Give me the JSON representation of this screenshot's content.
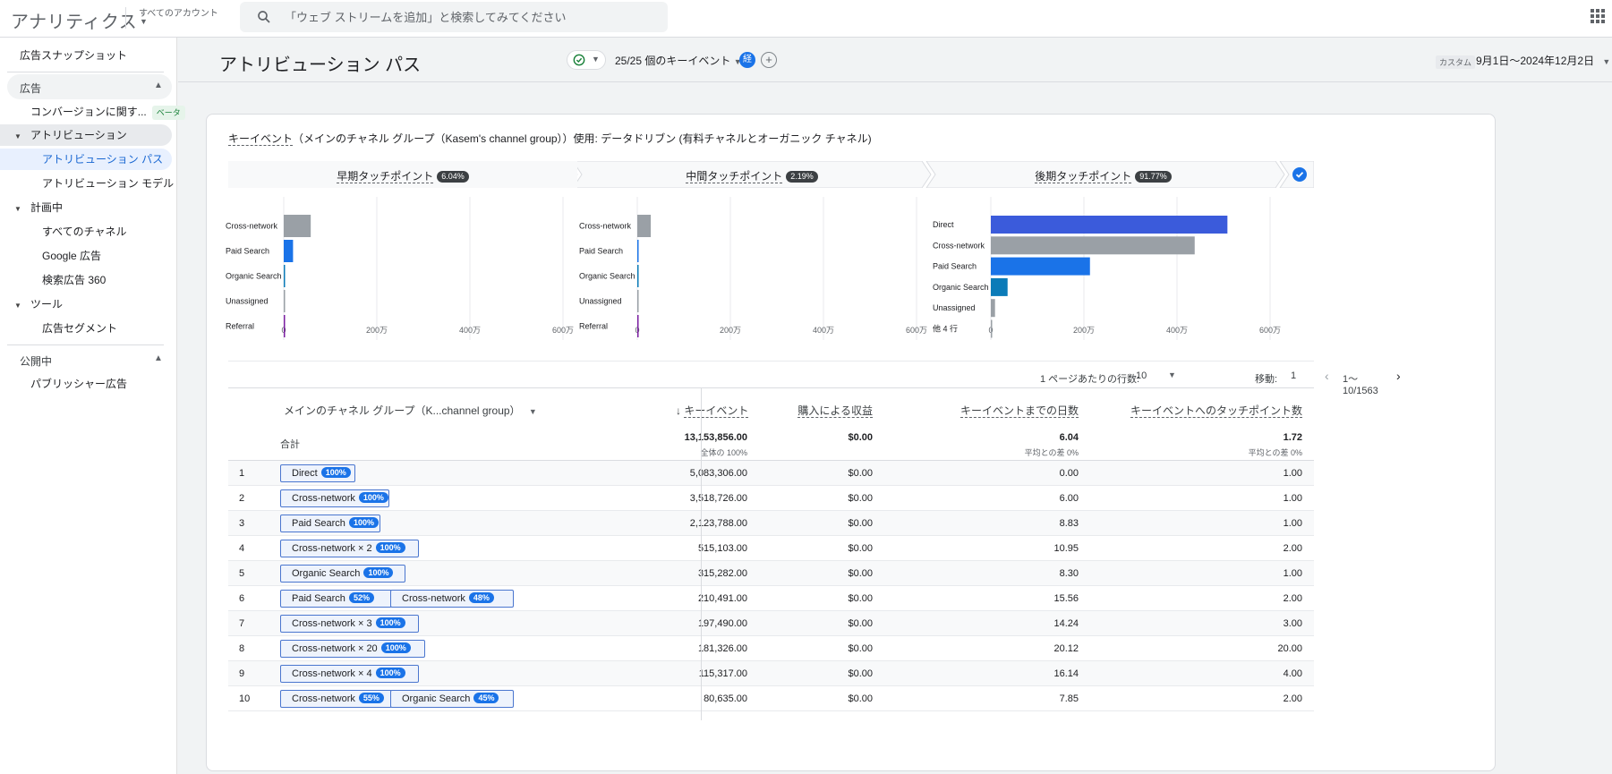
{
  "app": {
    "title": "アナリティクス",
    "account_label": "すべてのアカウント"
  },
  "search": {
    "placeholder": "「ウェブ ストリームを追加」と検索してみてください"
  },
  "sidebar": {
    "snapshot": "広告スナップショット",
    "sections": {
      "ads": "広告",
      "published": "公開中"
    },
    "items": {
      "conversion": "コンバージョンに関す...",
      "conversion_badge": "ベータ",
      "attribution": "アトリビューション",
      "attribution_paths": "アトリビューション パス",
      "attribution_model": "アトリビューション モデル",
      "planning": "計画中",
      "all_channels": "すべてのチャネル",
      "google_ads": "Google 広告",
      "sa360": "検索広告 360",
      "tools": "ツール",
      "segments": "広告セグメント",
      "publisher_ads": "パブリッシャー広告"
    }
  },
  "header": {
    "title": "アトリビューション パス",
    "events_dropdown": "25/25 個のキーイベント",
    "badge": "経",
    "add": "+",
    "date_custom": "カスタム",
    "date_range": "9月1日～2024年12月2日"
  },
  "filter": {
    "key_event": "キーイベント",
    "text": "（メインのチャネル グループ（Kasem's channel group））使用: データドリブン (有料チャネルとオーガニック チャネル)"
  },
  "touchpoints": [
    {
      "label": "早期タッチポイント",
      "pct": "6.04%"
    },
    {
      "label": "中間タッチポイント",
      "pct": "2.19%"
    },
    {
      "label": "後期タッチポイント",
      "pct": "91.77%"
    }
  ],
  "colors": {
    "accent": "#1a73e8",
    "direct": "#3b5bdb",
    "cross_network": "#9aa0a6",
    "paid_search": "#1a73e8",
    "organic_search": "#0b7bb8",
    "unassigned": "#9aa0a6",
    "referral": "#7b1fa2"
  },
  "chart_data": [
    {
      "type": "bar",
      "orientation": "horizontal",
      "categories": [
        "Cross-network",
        "Paid Search",
        "Organic Search",
        "Unassigned",
        "Referral"
      ],
      "values": [
        580000,
        200000,
        20000,
        10000,
        10000
      ],
      "xlim": [
        0,
        6000000
      ],
      "x_ticks": [
        "0",
        "200万",
        "400万",
        "600万"
      ]
    },
    {
      "type": "bar",
      "orientation": "horizontal",
      "categories": [
        "Cross-network",
        "Paid Search",
        "Organic Search",
        "Unassigned",
        "Referral"
      ],
      "values": [
        290000,
        20000,
        15000,
        10000,
        10000
      ],
      "xlim": [
        0,
        6000000
      ],
      "x_ticks": [
        "0",
        "200万",
        "400万",
        "600万"
      ]
    },
    {
      "type": "bar",
      "orientation": "horizontal",
      "categories": [
        "Direct",
        "Cross-network",
        "Paid Search",
        "Organic Search",
        "Unassigned",
        "他 4 行"
      ],
      "values": [
        5083306,
        4380000,
        2130000,
        360000,
        90000,
        20000
      ],
      "xlim": [
        0,
        6000000
      ],
      "x_ticks": [
        "0",
        "200万",
        "400万",
        "600万"
      ]
    }
  ],
  "pager": {
    "rows_label": "1 ページあたりの行数:",
    "rows_value": "10",
    "goto_label": "移動:",
    "goto_value": "1",
    "range": "1～10/1563"
  },
  "table": {
    "headers": {
      "dimension": "メインのチャネル グループ（K...channel group）",
      "key_events": "キーイベント",
      "revenue": "購入による収益",
      "days": "キーイベントまでの日数",
      "touchpoints": "キーイベントへのタッチポイント数"
    },
    "total": {
      "label": "合計",
      "key_events": "13,153,856.00",
      "key_events_sub": "全体の 100%",
      "revenue": "$0.00",
      "days": "6.04",
      "days_sub": "平均との差 0%",
      "touchpoints": "1.72",
      "touchpoints_sub": "平均との差 0%"
    },
    "rows": [
      {
        "idx": "1",
        "path": [
          {
            "name": "Direct",
            "pct": "100%"
          }
        ],
        "key_events": "5,083,306.00",
        "revenue": "$0.00",
        "days": "0.00",
        "touchpoints": "1.00"
      },
      {
        "idx": "2",
        "path": [
          {
            "name": "Cross-network",
            "pct": "100%"
          }
        ],
        "key_events": "3,518,726.00",
        "revenue": "$0.00",
        "days": "6.00",
        "touchpoints": "1.00"
      },
      {
        "idx": "3",
        "path": [
          {
            "name": "Paid Search",
            "pct": "100%"
          }
        ],
        "key_events": "2,123,788.00",
        "revenue": "$0.00",
        "days": "8.83",
        "touchpoints": "1.00"
      },
      {
        "idx": "4",
        "path": [
          {
            "name": "Cross-network × 2",
            "pct": "100%"
          }
        ],
        "key_events": "515,103.00",
        "revenue": "$0.00",
        "days": "10.95",
        "touchpoints": "2.00"
      },
      {
        "idx": "5",
        "path": [
          {
            "name": "Organic Search",
            "pct": "100%"
          }
        ],
        "key_events": "315,282.00",
        "revenue": "$0.00",
        "days": "8.30",
        "touchpoints": "1.00"
      },
      {
        "idx": "6",
        "path": [
          {
            "name": "Paid Search",
            "pct": "52%"
          },
          {
            "name": "Cross-network",
            "pct": "48%"
          }
        ],
        "key_events": "210,491.00",
        "revenue": "$0.00",
        "days": "15.56",
        "touchpoints": "2.00"
      },
      {
        "idx": "7",
        "path": [
          {
            "name": "Cross-network × 3",
            "pct": "100%"
          }
        ],
        "key_events": "197,490.00",
        "revenue": "$0.00",
        "days": "14.24",
        "touchpoints": "3.00"
      },
      {
        "idx": "8",
        "path": [
          {
            "name": "Cross-network × 20",
            "pct": "100%"
          }
        ],
        "key_events": "181,326.00",
        "revenue": "$0.00",
        "days": "20.12",
        "touchpoints": "20.00"
      },
      {
        "idx": "9",
        "path": [
          {
            "name": "Cross-network × 4",
            "pct": "100%"
          }
        ],
        "key_events": "115,317.00",
        "revenue": "$0.00",
        "days": "16.14",
        "touchpoints": "4.00"
      },
      {
        "idx": "10",
        "path": [
          {
            "name": "Cross-network",
            "pct": "55%"
          },
          {
            "name": "Organic Search",
            "pct": "45%"
          }
        ],
        "key_events": "80,635.00",
        "revenue": "$0.00",
        "days": "7.85",
        "touchpoints": "2.00"
      }
    ]
  }
}
